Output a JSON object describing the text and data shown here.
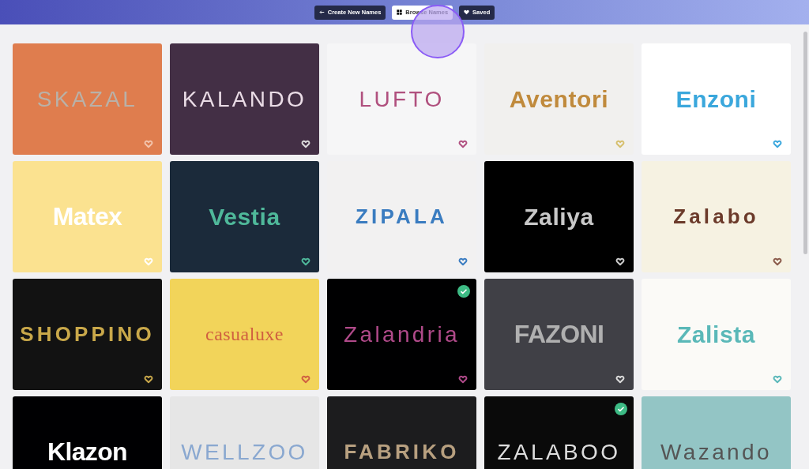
{
  "header": {
    "buttons": [
      {
        "label": "Create New Names",
        "kind": "back",
        "selected": false
      },
      {
        "label": "Browse Names",
        "kind": "grid",
        "selected": true
      },
      {
        "label": "Saved",
        "kind": "heart",
        "selected": false
      }
    ]
  },
  "cards": [
    {
      "color": "#df7d4e",
      "logo": {
        "text": "SKAZAL",
        "color": "#b9b1a8",
        "kind": "thin"
      },
      "heart": {
        "color": "#f3c4ac"
      },
      "saved": false
    },
    {
      "color": "#432f45",
      "logo": {
        "text": "KALANDO",
        "color": "#eadce6",
        "kind": "thin"
      },
      "heart": {
        "color": "#dddddd"
      },
      "saved": false
    },
    {
      "color": "#f6f6f7",
      "logo": {
        "text": "LUFTO",
        "color": "#b0507e",
        "kind": "thin"
      },
      "heart": {
        "color": "#b04f80"
      },
      "saved": false
    },
    {
      "color": "#f1f0ee",
      "logo": {
        "text": "Aventori",
        "color": "#c08a3c",
        "kind": "bold"
      },
      "heart": {
        "color": "#d6bf6c"
      },
      "saved": false
    },
    {
      "color": "#ffffff",
      "logo": {
        "text": "Enzoni",
        "color": "#3aa7dc",
        "kind": "bold"
      },
      "heart": {
        "color": "#3aa7dd"
      },
      "saved": false
    },
    {
      "color": "#fbe290",
      "logo": {
        "text": "Matex",
        "color": "#ffffff",
        "kind": "heavy"
      },
      "heart": {
        "color": "#fffffe"
      },
      "saved": false
    },
    {
      "color": "#1b2a3a",
      "logo": {
        "text": "Vestia",
        "color": "#4fb89a",
        "kind": "bold"
      },
      "heart": {
        "color": "#4fb89b"
      },
      "saved": false
    },
    {
      "color": "#f2f1f1",
      "logo": {
        "text": "ZIPALA",
        "color": "#3a7cc0",
        "kind": "spaced"
      },
      "heart": {
        "color": "#3a7cc1"
      },
      "saved": false
    },
    {
      "color": "#000000",
      "logo": {
        "text": "Zaliya",
        "color": "#c8c8c8",
        "kind": "bold"
      },
      "heart": {
        "color": "#cccccc"
      },
      "saved": false
    },
    {
      "color": "#f6f2e2",
      "logo": {
        "text": "Zalabo",
        "color": "#6b3a2a",
        "kind": "spaced"
      },
      "heart": {
        "color": "#8a5a4a"
      },
      "saved": false
    },
    {
      "color": "#121212",
      "logo": {
        "text": "SHOPPINO",
        "color": "#c9a84a",
        "kind": "spaced"
      },
      "heart": {
        "color": "#c9a84b"
      },
      "saved": false
    },
    {
      "color": "#f2d45a",
      "logo": {
        "text": "casualuxe",
        "color": "#d06040",
        "kind": "serif"
      },
      "heart": {
        "color": "#d06041"
      },
      "saved": false
    },
    {
      "color": "#000001",
      "logo": {
        "text": "Zalandria",
        "color": "#b04a8a",
        "kind": "thin"
      },
      "heart": {
        "color": "#b04a8b"
      },
      "saved": true
    },
    {
      "color": "#404046",
      "logo": {
        "text": "FAZONI",
        "color": "#b0b0b0",
        "kind": "heavy"
      },
      "heart": {
        "color": "#dcdcdc"
      },
      "saved": false
    },
    {
      "color": "#fbfaf7",
      "logo": {
        "text": "Zalista",
        "color": "#5ab8b8",
        "kind": "bold"
      },
      "heart": {
        "color": "#5ab8b9"
      },
      "saved": false
    },
    {
      "color": "#000002",
      "logo": {
        "text": "Klazon",
        "color": "#fefefe",
        "kind": "heavy"
      },
      "saved": false
    },
    {
      "color": "#e6e6e6",
      "logo": {
        "text": "WELLZOO",
        "color": "#8aa8d0",
        "kind": "thin"
      },
      "saved": false
    },
    {
      "color": "#1c1c1e",
      "logo": {
        "text": "FABRIKO",
        "color": "#b8a080",
        "kind": "spaced"
      },
      "saved": false
    },
    {
      "color": "#0a0a0a",
      "logo": {
        "text": "ZALABOO",
        "color": "#dedede",
        "kind": "thin"
      },
      "saved": true
    },
    {
      "color": "#93c5c5",
      "logo": {
        "text": "Wazando",
        "color": "#555555",
        "kind": "thin"
      },
      "saved": false
    }
  ]
}
